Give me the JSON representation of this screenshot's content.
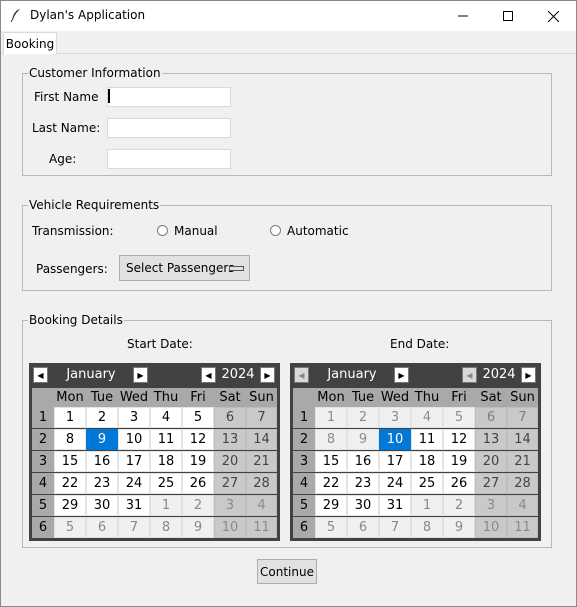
{
  "window": {
    "title": "Dylan's Application",
    "icon": "feather-icon",
    "controls": [
      "minimize-icon",
      "maximize-icon",
      "close-icon"
    ]
  },
  "tabs": [
    {
      "label": "Booking",
      "selected": true
    }
  ],
  "customer_info": {
    "title": "Customer Information",
    "first_name": {
      "label": "First Name",
      "value": ""
    },
    "last_name": {
      "label": "Last Name:",
      "value": ""
    },
    "age": {
      "label": "Age:",
      "value": ""
    }
  },
  "vehicle": {
    "title": "Vehicle Requirements",
    "transmission_label": "Transmission:",
    "options": [
      "Manual",
      "Automatic"
    ],
    "passengers_label": "Passengers:",
    "passengers_value": "Select Passengers"
  },
  "booking": {
    "title": "Booking Details",
    "start_label": "Start Date:",
    "end_label": "End Date:",
    "weekday_headers": [
      "Mon",
      "Tue",
      "Wed",
      "Thu",
      "Fri",
      "Sat",
      "Sun"
    ],
    "start_calendar": {
      "month": "January",
      "year": "2024",
      "selected_day": "9",
      "weeks": [
        "1",
        "2",
        "3",
        "4",
        "5",
        "6"
      ],
      "days": [
        [
          "1",
          "2",
          "3",
          "4",
          "5",
          "6",
          "7"
        ],
        [
          "8",
          "9",
          "10",
          "11",
          "12",
          "13",
          "14"
        ],
        [
          "15",
          "16",
          "17",
          "18",
          "19",
          "20",
          "21"
        ],
        [
          "22",
          "23",
          "24",
          "25",
          "26",
          "27",
          "28"
        ],
        [
          "29",
          "30",
          "31",
          "1",
          "2",
          "3",
          "4"
        ],
        [
          "5",
          "6",
          "7",
          "8",
          "9",
          "10",
          "11"
        ]
      ]
    },
    "end_calendar": {
      "month": "January",
      "year": "2024",
      "selected_day": "10",
      "weeks": [
        "1",
        "2",
        "3",
        "4",
        "5",
        "6"
      ],
      "days": [
        [
          "1",
          "2",
          "3",
          "4",
          "5",
          "6",
          "7"
        ],
        [
          "8",
          "9",
          "10",
          "11",
          "12",
          "13",
          "14"
        ],
        [
          "15",
          "16",
          "17",
          "18",
          "19",
          "20",
          "21"
        ],
        [
          "22",
          "23",
          "24",
          "25",
          "26",
          "27",
          "28"
        ],
        [
          "29",
          "30",
          "31",
          "1",
          "2",
          "3",
          "4"
        ],
        [
          "5",
          "6",
          "7",
          "8",
          "9",
          "10",
          "11"
        ]
      ]
    },
    "continue_label": "Continue"
  },
  "colors": {
    "selection": "#0078d7",
    "calendar_header": "#424242"
  }
}
